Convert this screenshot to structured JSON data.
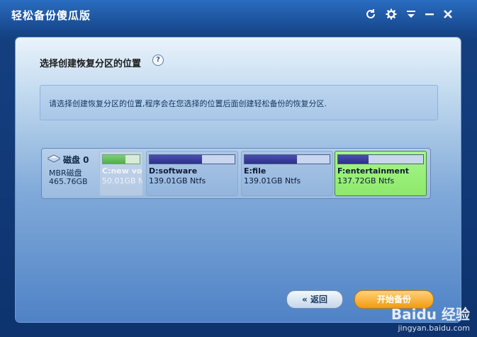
{
  "window": {
    "title": "轻松备份傻瓜版",
    "controls": {
      "refresh": "refresh-icon",
      "settings": "gear-icon",
      "menu": "dropdown-icon",
      "minimize": "minimize-icon",
      "close": "close-icon"
    }
  },
  "panel": {
    "heading": "选择创建恢复分区的位置",
    "help": "?",
    "info": "请选择创建恢复分区的位置,程序会在您选择的位置后面创建轻松备份的恢复分区."
  },
  "disk": {
    "name": "磁盘 0",
    "type": "MBR磁盘",
    "size": "465.76GB",
    "partitions": [
      {
        "label": "C:new vo",
        "size": "50.01GB N",
        "used_pct": 62,
        "state": "disabled"
      },
      {
        "label": "D:software",
        "size": "139.01GB Ntfs",
        "used_pct": 62,
        "state": "normal"
      },
      {
        "label": "E:file",
        "size": "139.01GB Ntfs",
        "used_pct": 62,
        "state": "normal"
      },
      {
        "label": "F:entertainment",
        "size": "137.72GB Ntfs",
        "used_pct": 36,
        "state": "selected"
      }
    ]
  },
  "buttons": {
    "back_label": "返回",
    "back_icon": "double-chevron-left-icon",
    "start_label": "开始备份"
  },
  "watermark": {
    "brand": "Baidu 经验",
    "url": "jingyan.baidu.com"
  },
  "colors": {
    "title_bar": "#17488d",
    "selected_partition": "#8ee96b",
    "start_button": "#f29a10"
  }
}
